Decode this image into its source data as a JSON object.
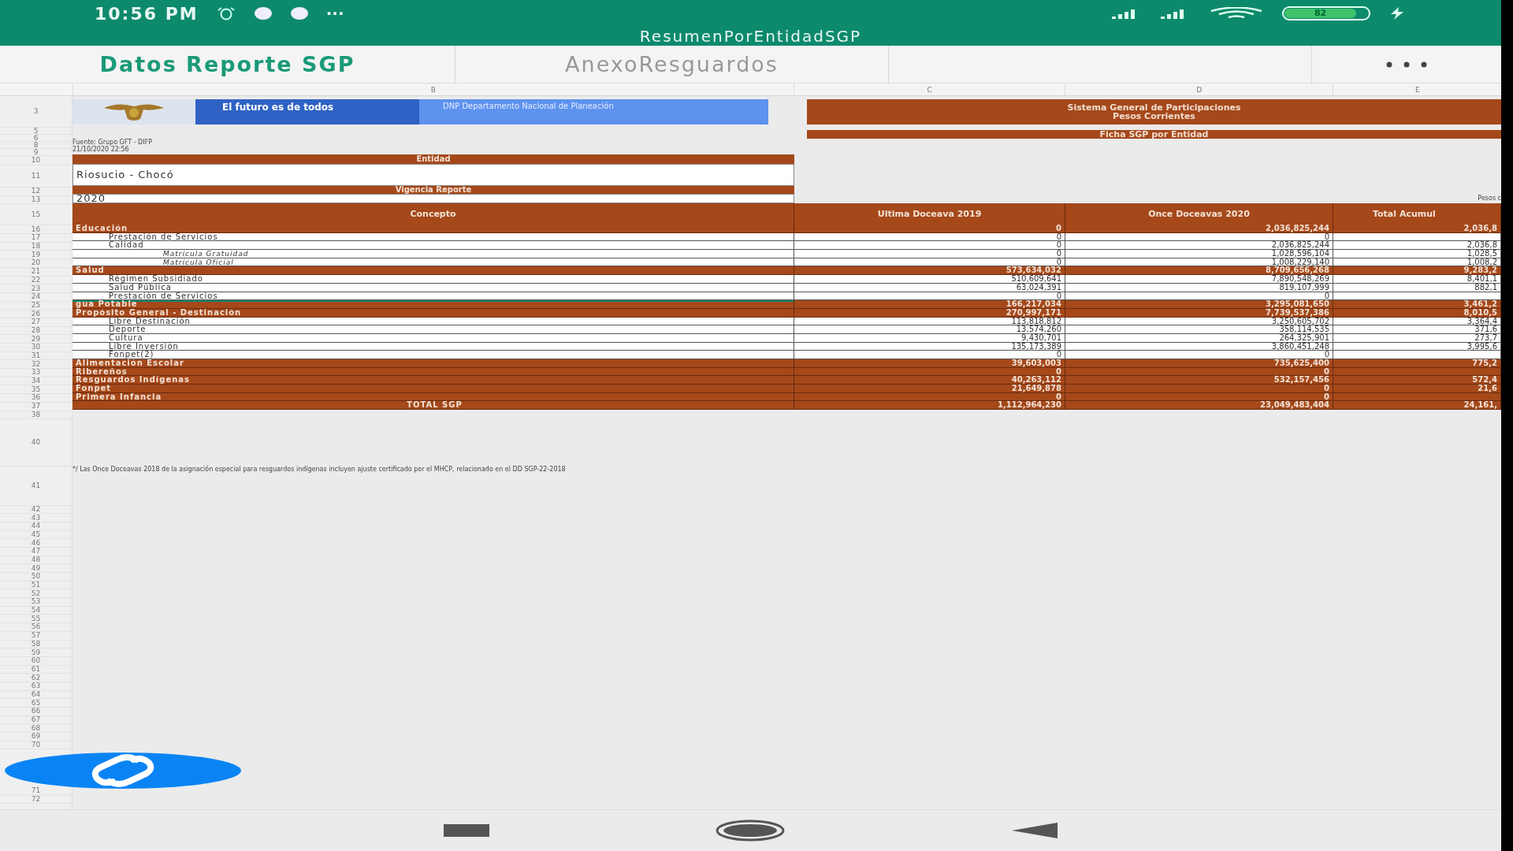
{
  "status_bar": {
    "time": "10:56 PM",
    "more": "···",
    "battery": "82"
  },
  "document_title": "ResumenPorEntidadSGP",
  "tabs": [
    {
      "label": "Datos Reporte SGP",
      "selected": true
    },
    {
      "label": "AnexoResguardos",
      "selected": false
    }
  ],
  "column_letters": [
    "B",
    "C",
    "D",
    "E"
  ],
  "row_numbers": [
    "3",
    "5",
    "6",
    "8",
    "9",
    "10",
    "11",
    "12",
    "13",
    "15",
    "16",
    "17",
    "18",
    "19",
    "20",
    "21",
    "22",
    "23",
    "24",
    "25",
    "26",
    "27",
    "28",
    "29",
    "30",
    "31",
    "32",
    "33",
    "34",
    "35",
    "36",
    "37",
    "38",
    "40",
    "41",
    "42",
    "43",
    "44",
    "45",
    "46",
    "47",
    "48",
    "49",
    "50",
    "51",
    "52",
    "53",
    "54",
    "55",
    "56",
    "57",
    "58",
    "59",
    "60",
    "61",
    "62",
    "63",
    "64",
    "65",
    "66",
    "67",
    "68",
    "69",
    "70",
    "71",
    "72"
  ],
  "banner": {
    "slogan": "El futuro es de todos",
    "agency": "DNP Departamento Nacional de Planeación"
  },
  "report_header": {
    "title": "Sistema General de Participaciones",
    "subtitle": "Pesos Corrientes",
    "sheet_title": "Ficha SGP por Entidad"
  },
  "source": "Fuente: Grupo GFT - DIFP",
  "generated": "21/10/2020 22:56",
  "entity": {
    "label": "Entidad",
    "value": "Riosucio - Chocó"
  },
  "period": {
    "label": "Vigencia Reporte",
    "value": "2020"
  },
  "units": "Pesos c",
  "table": {
    "columns": [
      "Concepto",
      "Ultima Doceava 2019",
      "Once Doceavas 2020",
      "Total Acumul"
    ],
    "rows": [
      {
        "kind": "section",
        "concept": "Educación",
        "values": [
          "0",
          "2,036,825,244",
          "2,036,8"
        ],
        "selected": false
      },
      {
        "kind": "item",
        "concept": "Prestación de Servicios",
        "values": [
          "0",
          "0"
        ],
        "selected": false
      },
      {
        "kind": "item",
        "concept": "Calidad",
        "values": [
          "0",
          "2,036,825,244",
          "2,036,8"
        ],
        "selected": false
      },
      {
        "kind": "subitem",
        "concept": "Matrícula Gratuidad",
        "values": [
          "0",
          "1,028,596,104",
          "1,028,5"
        ],
        "selected": false
      },
      {
        "kind": "subitem",
        "concept": "Matrícula Oficial",
        "values": [
          "0",
          "1,008,229,140",
          "1,008,2"
        ],
        "selected": false
      },
      {
        "kind": "section",
        "concept": "Salud",
        "values": [
          "573,634,032",
          "8,709,656,268",
          "9,283,2"
        ],
        "selected": false
      },
      {
        "kind": "item",
        "concept": "Régimen Subsidiado",
        "values": [
          "510,609,641",
          "7,890,548,269",
          "8,401,1"
        ],
        "selected": false
      },
      {
        "kind": "item",
        "concept": "Salud Pública",
        "values": [
          "63,024,391",
          "819,107,999",
          "882,1"
        ],
        "selected": false
      },
      {
        "kind": "item",
        "concept": "Prestación de Servicios",
        "values": [
          "0",
          "0"
        ],
        "selected": false
      },
      {
        "kind": "section",
        "concept": "gua Potable",
        "values": [
          "166,217,034",
          "3,295,081,650",
          "3,461,2"
        ],
        "selected": true
      },
      {
        "kind": "section",
        "concept": "Propósito General - Destinación",
        "values": [
          "270,997,171",
          "7,739,537,386",
          "8,010,5"
        ],
        "selected": false
      },
      {
        "kind": "item",
        "concept": "Libre Destinación",
        "values": [
          "113,818,812",
          "3,250,605,702",
          "3,364,4"
        ],
        "selected": false
      },
      {
        "kind": "item",
        "concept": "Deporte",
        "values": [
          "13,574,260",
          "358,114,535",
          "371,6"
        ],
        "selected": false
      },
      {
        "kind": "item",
        "concept": "Cultura",
        "values": [
          "9,430,701",
          "264,325,901",
          "273,7"
        ],
        "selected": false
      },
      {
        "kind": "item",
        "concept": "Libre Inversión",
        "values": [
          "135,173,389",
          "3,860,451,248",
          "3,995,6"
        ],
        "selected": false
      },
      {
        "kind": "item",
        "concept": "Fonpet(2)",
        "values": [
          "0",
          "0"
        ],
        "selected": false
      },
      {
        "kind": "section",
        "concept": "Alimentación Escolar",
        "values": [
          "39,603,003",
          "735,625,400",
          "775,2"
        ],
        "selected": false
      },
      {
        "kind": "section",
        "concept": "Ribereños",
        "values": [
          "0",
          "0"
        ],
        "selected": false
      },
      {
        "kind": "section",
        "concept": "Resguardos Indígenas",
        "values": [
          "40,263,112",
          "532,157,456",
          "572,4"
        ],
        "selected": false
      },
      {
        "kind": "section",
        "concept": "Fonpet",
        "values": [
          "21,649,878",
          "0",
          "21,6"
        ],
        "selected": false
      },
      {
        "kind": "section",
        "concept": "Primera Infancia",
        "values": [
          "0",
          "0"
        ],
        "selected": false
      },
      {
        "kind": "total",
        "concept": "TOTAL SGP",
        "values": [
          "1,112,964,230",
          "23,049,483,404",
          "24,161,"
        ],
        "selected": false
      }
    ]
  },
  "footnote": "*/ Las Once Doceavas 2018 de la asignación especial para resguardos indígenas incluyen ajuste certificado por el MHCP, relacionado en el DD SGP-22-2018"
}
